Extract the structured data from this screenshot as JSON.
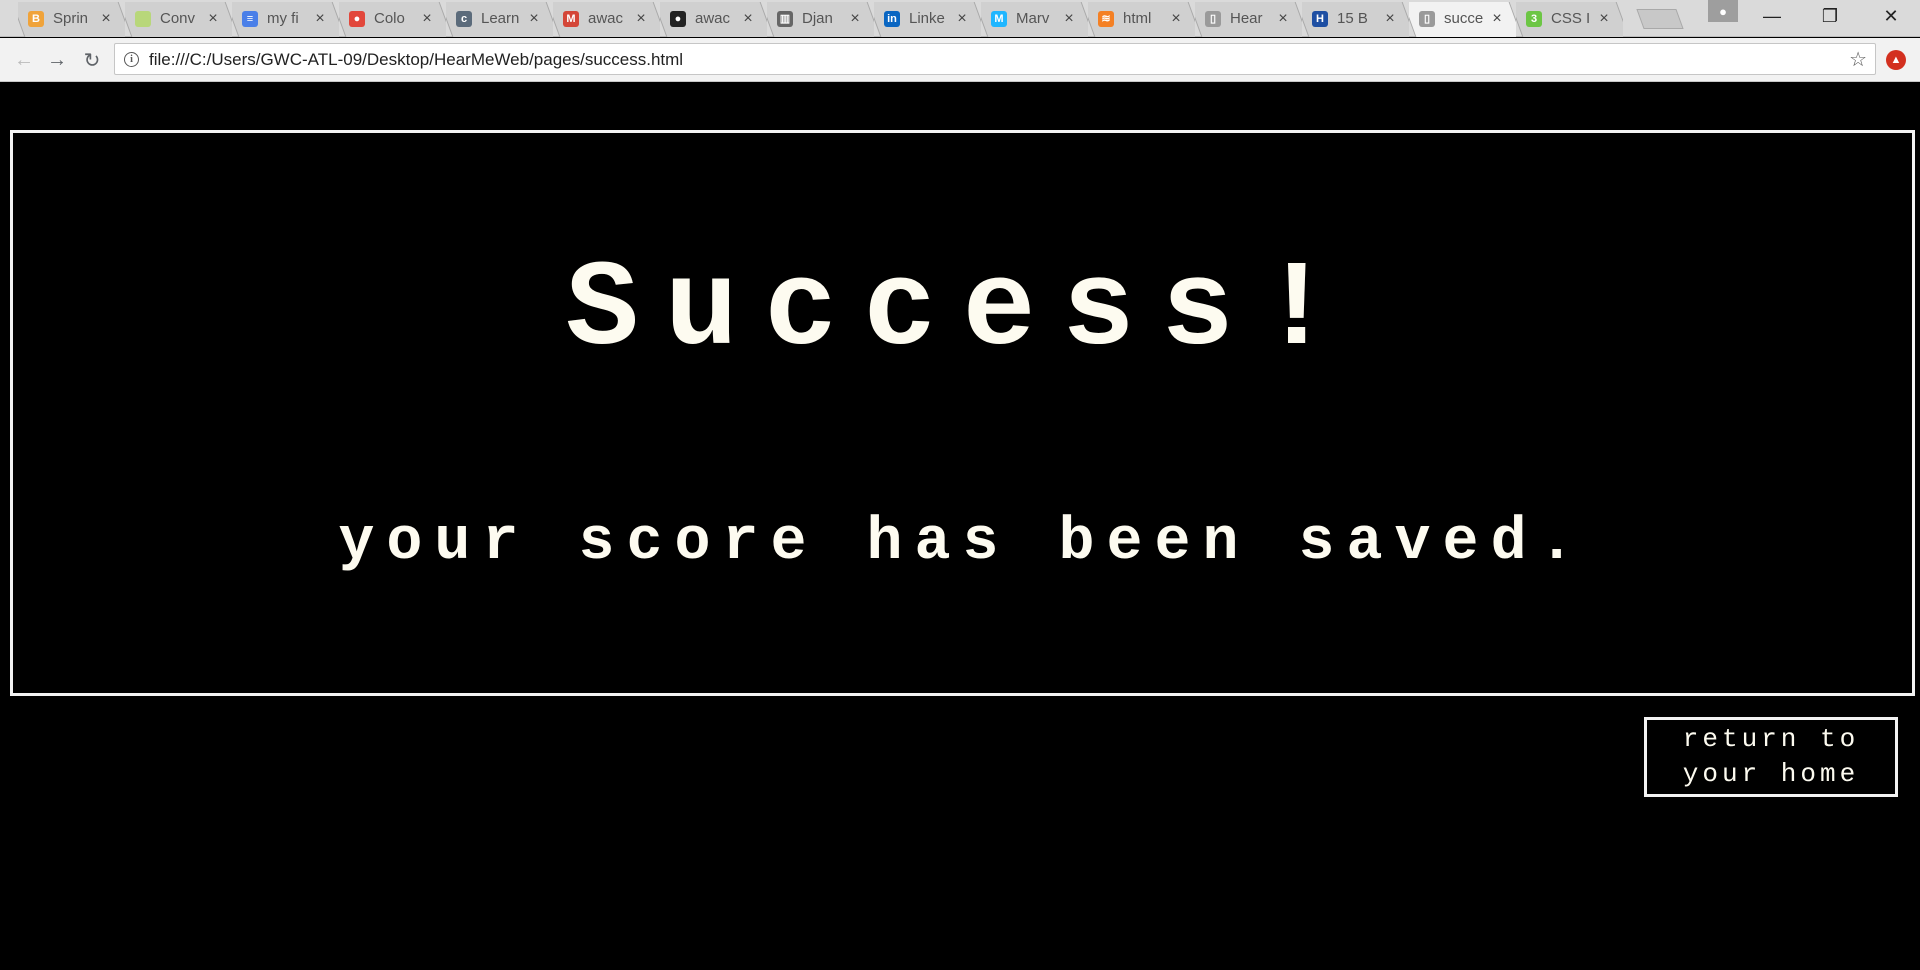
{
  "browser": {
    "tabs": [
      {
        "title": "Sprin",
        "favicon": "bootstrap-icon",
        "color": "#f0a33a",
        "glyph": "B"
      },
      {
        "title": "Conv",
        "favicon": "convert-icon",
        "color": "#b8d77a",
        "glyph": ""
      },
      {
        "title": "my fi",
        "favicon": "google-docs-icon",
        "color": "#4a7fe8",
        "glyph": "≡"
      },
      {
        "title": "Colo",
        "favicon": "color-wheel-icon",
        "color": "#e2473b",
        "glyph": "●"
      },
      {
        "title": "Learn",
        "favicon": "codecademy-icon",
        "color": "#5b6b7b",
        "glyph": "c"
      },
      {
        "title": "awac",
        "favicon": "gmail-icon",
        "color": "#d44638",
        "glyph": "M"
      },
      {
        "title": "awac",
        "favicon": "github-icon",
        "color": "#222222",
        "glyph": "●"
      },
      {
        "title": "Djan",
        "favicon": "book-icon",
        "color": "#666666",
        "glyph": "▥"
      },
      {
        "title": "Linke",
        "favicon": "linkedin-icon",
        "color": "#0a66c2",
        "glyph": "in"
      },
      {
        "title": "Marv",
        "favicon": "marvel-icon",
        "color": "#1fb6ff",
        "glyph": "M"
      },
      {
        "title": "html",
        "favicon": "stackoverflow-icon",
        "color": "#f48024",
        "glyph": "≋"
      },
      {
        "title": "Hear",
        "favicon": "file-icon",
        "color": "#9a9a9a",
        "glyph": "▯"
      },
      {
        "title": "15 B",
        "favicon": "h-logo-icon",
        "color": "#1e4fa3",
        "glyph": "H"
      },
      {
        "title": "succe",
        "favicon": "file-icon",
        "color": "#9a9a9a",
        "glyph": "▯",
        "active": true
      },
      {
        "title": "CSS I",
        "favicon": "css-icon",
        "color": "#6cc644",
        "glyph": "3"
      }
    ],
    "url": "file:///C:/Users/GWC-ATL-09/Desktop/HearMeWeb/pages/success.html"
  },
  "page": {
    "headline": "Success!",
    "subline": "your score has been saved.",
    "home_button": {
      "line1": "return to",
      "line2": "your home"
    }
  }
}
